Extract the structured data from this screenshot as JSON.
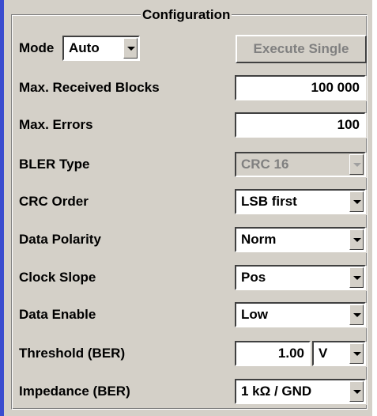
{
  "group_title": "Configuration",
  "mode": {
    "label": "Mode",
    "value": "Auto"
  },
  "execute_button": {
    "label": "Execute Single",
    "enabled": false
  },
  "rows": {
    "max_received_blocks": {
      "label": "Max. Received Blocks",
      "value": "100 000"
    },
    "max_errors": {
      "label": "Max. Errors",
      "value": "100"
    },
    "bler_type": {
      "label": "BLER Type",
      "value": "CRC 16",
      "enabled": false
    },
    "crc_order": {
      "label": "CRC Order",
      "value": "LSB first"
    },
    "data_polarity": {
      "label": "Data Polarity",
      "value": "Norm"
    },
    "clock_slope": {
      "label": "Clock Slope",
      "value": "Pos"
    },
    "data_enable": {
      "label": "Data Enable",
      "value": "Low"
    },
    "threshold": {
      "label": "Threshold (BER)",
      "value": "1.00",
      "unit": "V"
    },
    "impedance": {
      "label": "Impedance (BER)",
      "value": "1 kΩ / GND"
    }
  },
  "icons": {
    "dropdown": "chevron-down-icon"
  },
  "colors": {
    "panel": "#d4d0c8",
    "accent": "#3a4ccf",
    "disabled_text": "#808080"
  }
}
